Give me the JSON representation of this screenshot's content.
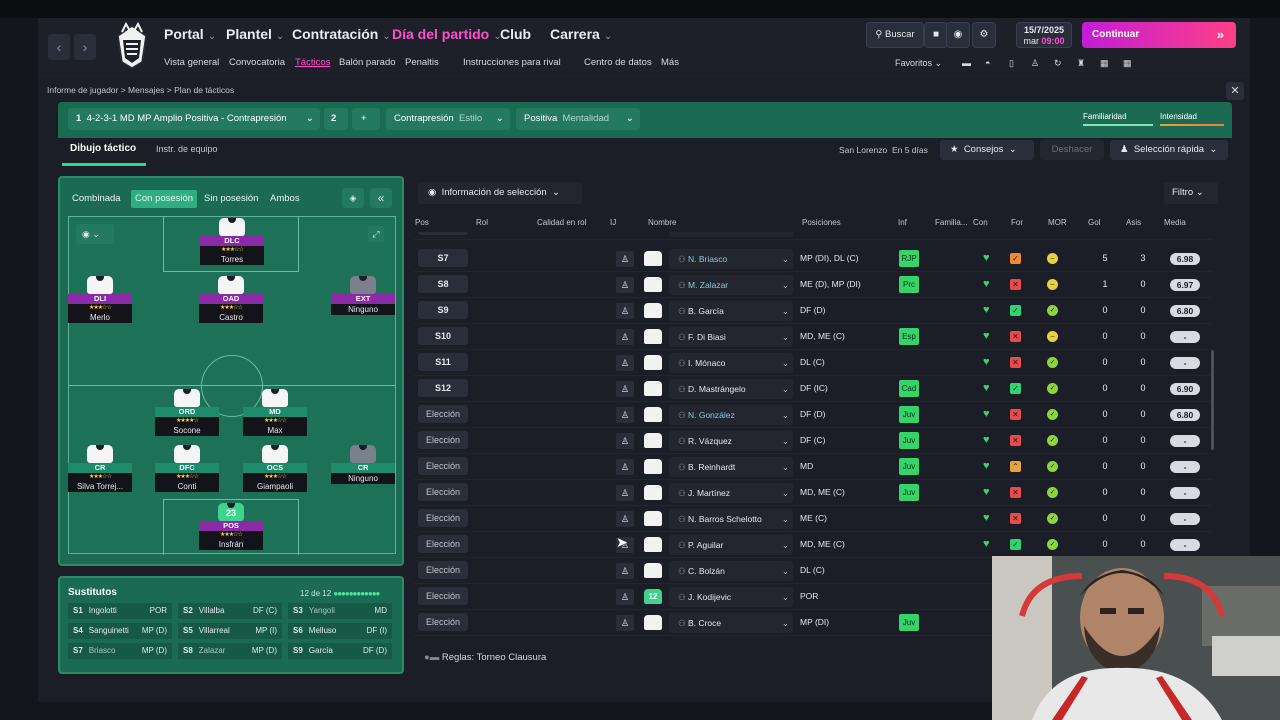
{
  "nav": {
    "back": "‹",
    "forward": "›",
    "main": [
      {
        "label": "Portal",
        "active": false
      },
      {
        "label": "Plantel",
        "active": false
      },
      {
        "label": "Contratación",
        "active": false
      },
      {
        "label": "Día del partido",
        "active": true
      },
      {
        "label": "Club",
        "active": false
      },
      {
        "label": "Carrera",
        "active": false
      }
    ],
    "sub": [
      {
        "label": "Vista general",
        "active": false
      },
      {
        "label": "Convocatoria",
        "active": false
      },
      {
        "label": "Tácticos",
        "active": true
      },
      {
        "label": "Balón parado",
        "active": false
      },
      {
        "label": "Penaltis",
        "active": false
      },
      {
        "label": "Instrucciones para rival",
        "active": false
      },
      {
        "label": "Centro de datos",
        "active": false
      },
      {
        "label": "Más",
        "active": false
      }
    ],
    "search": "Buscar",
    "date": "15/7/2025",
    "day": "mar",
    "time": "09:00",
    "continue": "Continuar",
    "favorites": "Favoritos"
  },
  "breadcrumb": [
    "Informe de jugador",
    "Mensajes",
    "Plan de tácticos"
  ],
  "tactic": {
    "number": "1",
    "formation": "4-2-3-1 MD MP Amplio Positiva - Contrapresión",
    "slot": "2",
    "style_value": "Contrapresión",
    "style_label": "Estilo",
    "mentality_value": "Positiva",
    "mentality_label": "Mentalidad",
    "familiarity": "Familiaridad",
    "intensity": "Intensidad"
  },
  "tabs": {
    "tactical": "Dibujo táctico",
    "team": "Instr. de equipo"
  },
  "toolbar": {
    "opponent": "San Lorenzo",
    "days": "En 5 días",
    "advice": "Consejos",
    "undo": "Deshacer",
    "quick": "Selección rápida"
  },
  "pitch_tabs": [
    "Combinada",
    "Con posesión",
    "Sin posesión",
    "Ambos"
  ],
  "pitch_tab_active": 1,
  "formation_players": [
    {
      "role": "DLC",
      "name": "Torres",
      "stars": "★★★☆☆",
      "color": "purple",
      "empty": false
    },
    {
      "role": "DLI",
      "name": "Merlo",
      "stars": "★★★☆☆",
      "color": "purple",
      "empty": false
    },
    {
      "role": "OAD",
      "name": "Castro",
      "stars": "★★★☆☆",
      "color": "purple",
      "empty": false
    },
    {
      "role": "EXT",
      "name": "Ninguno",
      "stars": "",
      "color": "purple",
      "empty": true
    },
    {
      "role": "ORD",
      "name": "Socone",
      "stars": "★★★★☆",
      "color": "green",
      "empty": false
    },
    {
      "role": "MD",
      "name": "Max",
      "stars": "★★★☆☆",
      "color": "green",
      "empty": false
    },
    {
      "role": "CR",
      "name": "Silva Torrej...",
      "stars": "★★★☆☆",
      "color": "green",
      "empty": false
    },
    {
      "role": "DFC",
      "name": "Conti",
      "stars": "★★★☆☆",
      "color": "green",
      "empty": false
    },
    {
      "role": "OCS",
      "name": "Giampaoli",
      "stars": "★★★☆☆",
      "color": "green",
      "empty": false
    },
    {
      "role": "CR",
      "name": "Ninguno",
      "stars": "",
      "color": "green",
      "empty": true
    },
    {
      "role": "POS",
      "name": "Insfrán",
      "stars": "★★★☆☆",
      "color": "purple",
      "empty": false,
      "number": "23"
    }
  ],
  "subs": {
    "title": "Sustitutos",
    "count": "12 de 12",
    "items": [
      {
        "slot": "S1",
        "name": "Ingolotti",
        "pos": "POR",
        "faded": false
      },
      {
        "slot": "S2",
        "name": "Villalba",
        "pos": "DF (C)",
        "faded": false
      },
      {
        "slot": "S3",
        "name": "Yangoli",
        "pos": "MD",
        "faded": true
      },
      {
        "slot": "S4",
        "name": "Sanguinetti",
        "pos": "MP (D)",
        "faded": false
      },
      {
        "slot": "S5",
        "name": "Villarreal",
        "pos": "MP (I)",
        "faded": false
      },
      {
        "slot": "S6",
        "name": "Melluso",
        "pos": "DF (I)",
        "faded": false
      },
      {
        "slot": "S7",
        "name": "Briasco",
        "pos": "MP (D)",
        "faded": true
      },
      {
        "slot": "S8",
        "name": "Zalazar",
        "pos": "MP (D)",
        "faded": true
      },
      {
        "slot": "S9",
        "name": "García",
        "pos": "DF (D)",
        "faded": false
      }
    ]
  },
  "selection_info": "Información de selección",
  "filter": "Filtro",
  "columns": [
    "Pos",
    "Rol",
    "Calidad en rol",
    "IJ",
    "Nombre",
    "Posiciones",
    "Inf",
    "Familia...",
    "Con",
    "For",
    "MOR",
    "Gol",
    "Asis",
    "Media"
  ],
  "rows": [
    {
      "pos": "S7",
      "name": "N. Briasco",
      "faded": true,
      "positions": "MP (DI), DL (C)",
      "inf": "RJP",
      "for": "orange",
      "mor": "yellow",
      "gol": "5",
      "asis": "3",
      "media": "6.98"
    },
    {
      "pos": "S8",
      "name": "M. Zalazar",
      "faded": true,
      "positions": "ME (D), MP (DI)",
      "inf": "Prc",
      "for": "red",
      "mor": "yellow",
      "gol": "1",
      "asis": "0",
      "media": "6.97"
    },
    {
      "pos": "S9",
      "name": "B. García",
      "faded": false,
      "positions": "DF (D)",
      "inf": "",
      "for": "green",
      "mor": "green",
      "gol": "0",
      "asis": "0",
      "media": "6.80"
    },
    {
      "pos": "S10",
      "name": "F. Di Biasi",
      "faded": false,
      "positions": "MD, ME (C)",
      "inf": "Esp",
      "for": "red",
      "mor": "yellow",
      "gol": "0",
      "asis": "0",
      "media": "-"
    },
    {
      "pos": "S11",
      "name": "I. Mónaco",
      "faded": false,
      "positions": "DL (C)",
      "inf": "",
      "for": "red",
      "mor": "green",
      "gol": "0",
      "asis": "0",
      "media": "-"
    },
    {
      "pos": "S12",
      "name": "D. Mastrángelo",
      "faded": false,
      "positions": "DF (IC)",
      "inf": "Cad",
      "for": "green",
      "mor": "green",
      "gol": "0",
      "asis": "0",
      "media": "6.90"
    },
    {
      "pos": "Elección",
      "name": "N. González",
      "faded": true,
      "positions": "DF (D)",
      "inf": "Juv",
      "for": "redx",
      "mor": "green",
      "gol": "0",
      "asis": "0",
      "media": "6.80"
    },
    {
      "pos": "Elección",
      "name": "R. Vázquez",
      "faded": false,
      "positions": "DF (C)",
      "inf": "Juv",
      "for": "redx",
      "mor": "green",
      "gol": "0",
      "asis": "0",
      "media": "-"
    },
    {
      "pos": "Elección",
      "name": "B. Reinhardt",
      "faded": false,
      "positions": "MD",
      "inf": "Juv",
      "for": "up",
      "mor": "green",
      "gol": "0",
      "asis": "0",
      "media": "-"
    },
    {
      "pos": "Elección",
      "name": "J. Martínez",
      "faded": false,
      "positions": "MD, ME (C)",
      "inf": "Juv",
      "for": "redx",
      "mor": "green",
      "gol": "0",
      "asis": "0",
      "media": "-"
    },
    {
      "pos": "Elección",
      "name": "N. Barros Schelotto",
      "faded": false,
      "positions": "ME (C)",
      "inf": "",
      "for": "redx",
      "mor": "green",
      "gol": "0",
      "asis": "0",
      "media": "-"
    },
    {
      "pos": "Elección",
      "name": "P. Aguilar",
      "faded": false,
      "positions": "MD, ME (C)",
      "inf": "",
      "for": "green",
      "mor": "green",
      "gol": "0",
      "asis": "0",
      "media": "-"
    },
    {
      "pos": "Elección",
      "name": "C. Bolzán",
      "faded": false,
      "positions": "DL (C)",
      "inf": "",
      "for": "",
      "mor": "",
      "gol": "",
      "asis": "",
      "media": ""
    },
    {
      "pos": "Elección",
      "name": "J. Kodijevic",
      "faded": false,
      "positions": "POR",
      "inf": "",
      "for": "",
      "mor": "",
      "gol": "",
      "asis": "",
      "media": "",
      "number": "12"
    },
    {
      "pos": "Elección",
      "name": "B. Croce",
      "faded": false,
      "positions": "MP (DI)",
      "inf": "Juv",
      "for": "",
      "mor": "",
      "gol": "",
      "asis": "",
      "media": ""
    }
  ],
  "rules": "Reglas: Torneo Clausura",
  "colors": {
    "accent": "#ff4fd0",
    "pitch": "#1a6b52",
    "positive": "#3fd36f"
  }
}
